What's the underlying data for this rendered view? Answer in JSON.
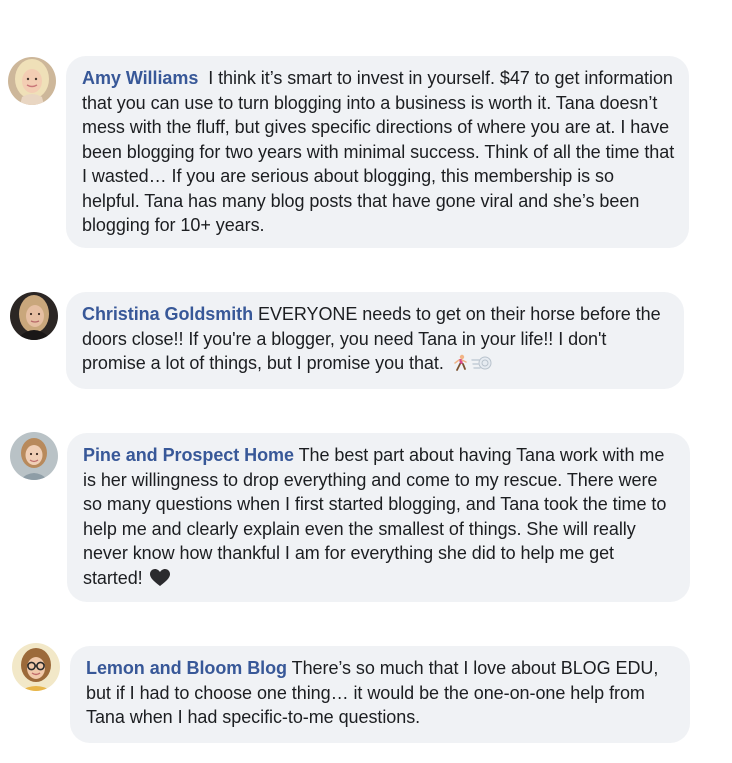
{
  "comments": [
    {
      "author": "Amy Williams",
      "text": "I think it’s smart to invest in yourself.  $47 to get information that you can use to turn blogging into a business is worth it. Tana doesn’t mess with the fluff, but gives specific directions of where you are at. I have been blogging for two years with minimal success. Think of all the time that I wasted… If you are serious about blogging, this membership is so helpful. Tana has many blog posts that have gone viral and she’s been blogging for 10+ years."
    },
    {
      "author": "Christina Goldsmith",
      "text": "EVERYONE needs to get on their horse before the doors close!! If you're a blogger, you need Tana in your life!! I don't promise a lot of things, but I promise you that.",
      "emojis": [
        "running-woman-icon",
        "dash-icon"
      ]
    },
    {
      "author": "Pine and Prospect Home",
      "text": "The best part about having Tana work with me is her willingness to drop everything and come to my rescue. There were so many questions when I first started blogging, and Tana took the time to help me and clearly explain even the smallest of things. She will really never know how thankful I am for everything she did to help me get started!",
      "emojis": [
        "black-heart-icon"
      ]
    },
    {
      "author": "Lemon and Bloom Blog",
      "text": "There’s so much that I love about BLOG EDU, but if I had to choose one thing… it would be the one-on-one help from Tana when I had specific-to-me questions."
    }
  ]
}
